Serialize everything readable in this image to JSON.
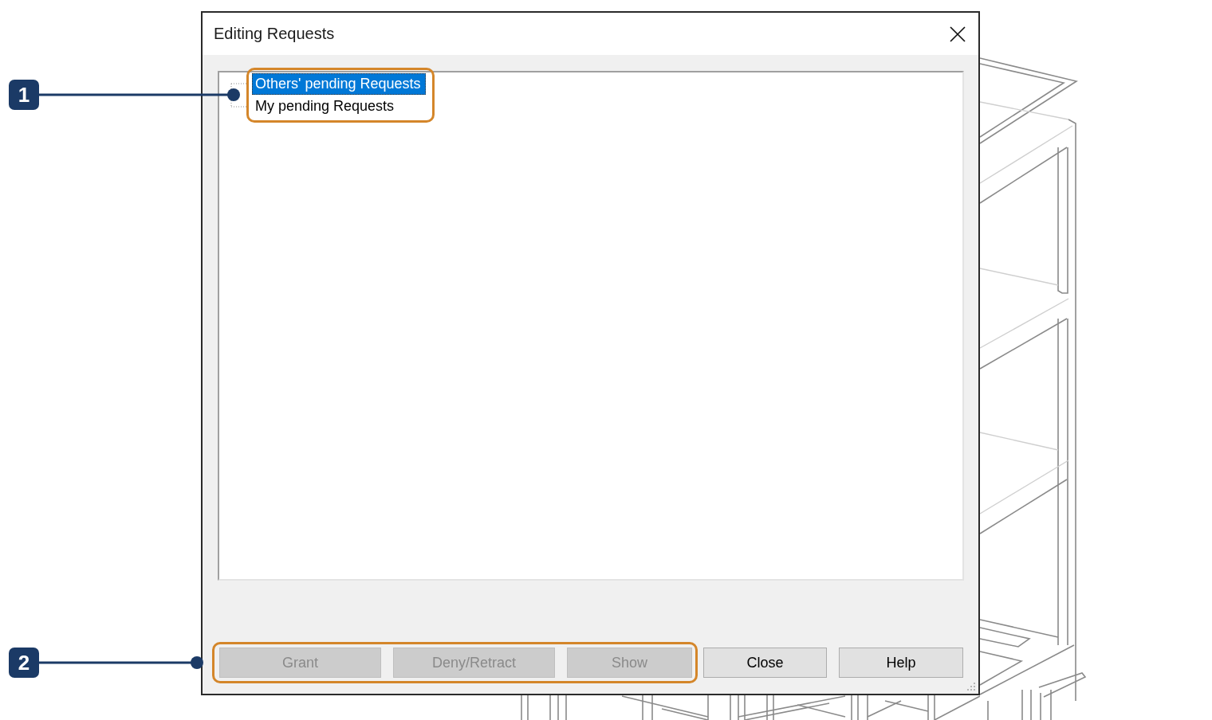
{
  "window": {
    "title": "Editing Requests"
  },
  "tree": {
    "callout": "1",
    "items": [
      {
        "label": "Others' pending Requests",
        "selected": true
      },
      {
        "label": "My pending Requests",
        "selected": false
      }
    ]
  },
  "button_row": {
    "callout": "2",
    "highlighted_buttons": [
      {
        "label": "Grant",
        "disabled": true
      },
      {
        "label": "Deny/Retract",
        "disabled": true
      },
      {
        "label": "Show",
        "disabled": true
      }
    ],
    "buttons": [
      {
        "label": "Close",
        "disabled": false
      },
      {
        "label": "Help",
        "disabled": false
      }
    ]
  }
}
